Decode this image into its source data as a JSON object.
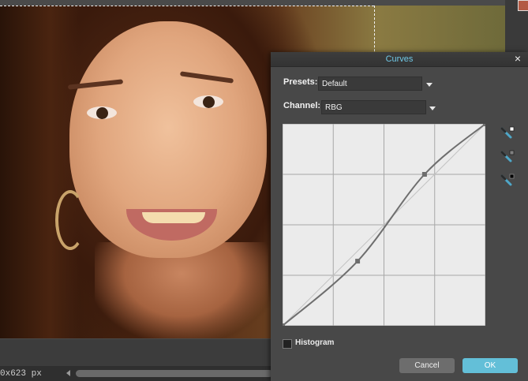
{
  "canvas": {
    "status_text": "0x623 px"
  },
  "dialog": {
    "title": "Curves",
    "close_glyph": "×",
    "presets_label": "Presets:",
    "presets_value": "Default",
    "channel_label": "Channel:",
    "channel_value": "RBG",
    "histogram_label": "Histogram",
    "histogram_checked": false,
    "cancel_label": "Cancel",
    "ok_label": "OK",
    "eyedroppers": [
      "white-point-eyedropper-icon",
      "gray-point-eyedropper-icon",
      "black-point-eyedropper-icon"
    ]
  },
  "curve": {
    "control_points": [
      [
        0,
        0
      ],
      [
        0.37,
        0.32
      ],
      [
        0.7,
        0.75
      ],
      [
        1,
        1
      ]
    ],
    "grid_divisions": 4,
    "colors": {
      "background": "#ebebeb",
      "grid": "#a7a7a7",
      "curve": "#6e6e6e",
      "baseline": "#c2c2c2"
    }
  },
  "colors": {
    "accent": "#63bfd8",
    "title": "#6fc8e6"
  }
}
